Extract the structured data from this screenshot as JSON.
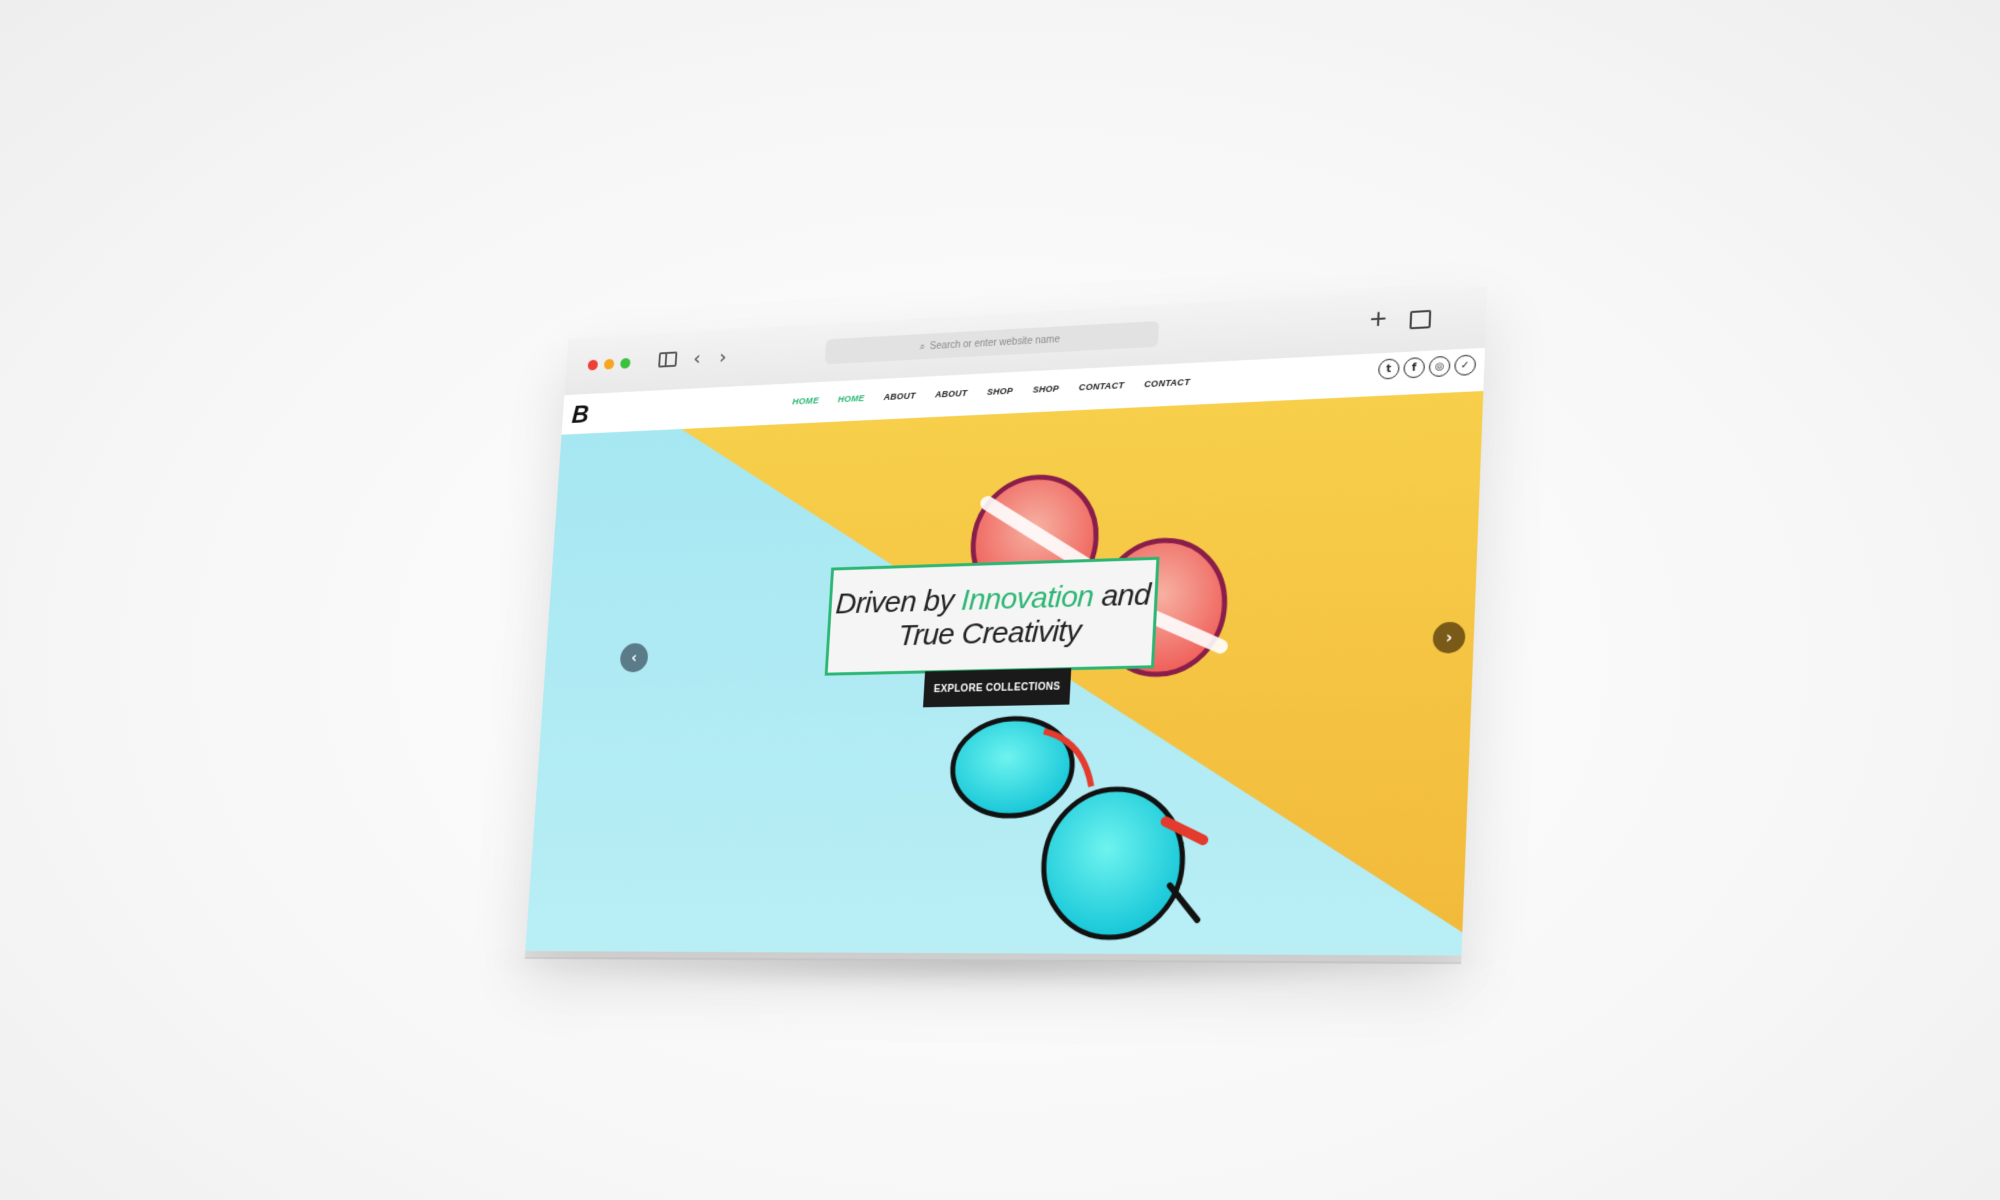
{
  "browser": {
    "address_placeholder": "Search or enter website name"
  },
  "site": {
    "logo": "B",
    "menu": [
      "HOME",
      "HOME",
      "ABOUT",
      "ABOUT",
      "SHOP",
      "SHOP",
      "CONTACT",
      "CONTACT"
    ],
    "social": [
      "t",
      "f",
      "◎",
      "✓"
    ]
  },
  "hero": {
    "headline_part1": "Driven by ",
    "headline_accent": "Innovation",
    "headline_part2": " and",
    "headline_line2": "True Creativity",
    "cta_label": "EXPLORE COLLECTIONS",
    "prev_glyph": "‹",
    "next_glyph": "›"
  },
  "colors": {
    "accent": "#2bb673",
    "hero_yellow": "#f2b93a",
    "hero_blue": "#a8e6f0"
  }
}
